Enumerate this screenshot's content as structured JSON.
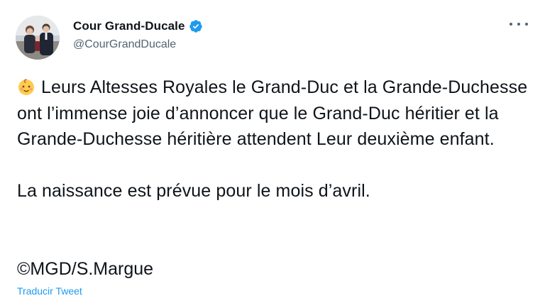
{
  "tweet": {
    "author": {
      "display_name": "Cour Grand-Ducale",
      "handle": "@CourGrandDucale",
      "verified": true,
      "avatar": "photo-avatar"
    },
    "more_icon": "more-horizontal-icon",
    "emoji": "baby-emoji",
    "paragraph_1": "Leurs Altesses Royales le Grand-Duc et la Grande-Duchesse ont l’immense joie d’annoncer que le Grand-Duc héritier et la Grande-Duchesse héritière attendent Leur deuxième enfant.",
    "paragraph_2": "La naissance est prévue pour le mois d’avril.",
    "credit": "©MGD/S.Margue",
    "translate_label": "Traducir Tweet"
  },
  "colors": {
    "text": "#0f1419",
    "secondary": "#536471",
    "link": "#1d9bf0",
    "verified": "#1d9bf0"
  }
}
